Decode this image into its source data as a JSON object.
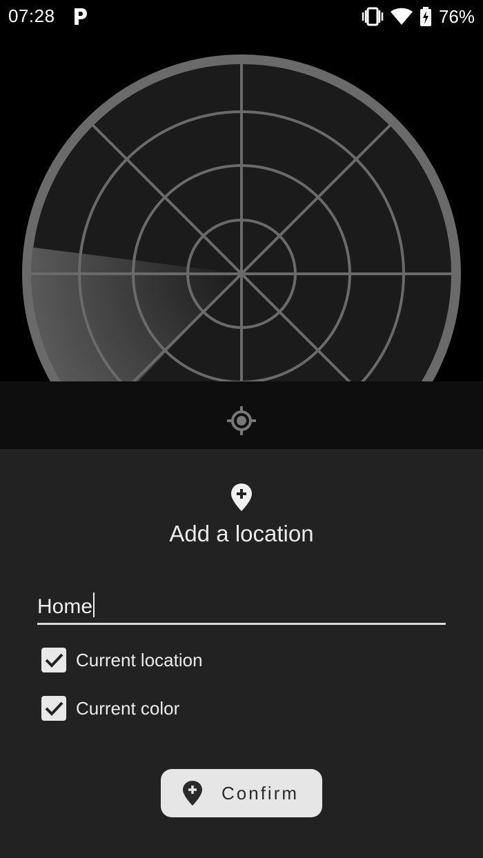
{
  "status_bar": {
    "time": "07:28",
    "battery_percent": "76%"
  },
  "sheet": {
    "title": "Add a location",
    "name_input_value": "Home",
    "checkboxes": [
      {
        "label": "Current location",
        "checked": true
      },
      {
        "label": "Current color",
        "checked": true
      }
    ],
    "confirm_label": "Confirm"
  },
  "colors": {
    "background": "#000000",
    "radar_face": "#1b1b1b",
    "radar_lines": "#666666",
    "sheet": "#222222",
    "button": "#e6e6e6"
  }
}
